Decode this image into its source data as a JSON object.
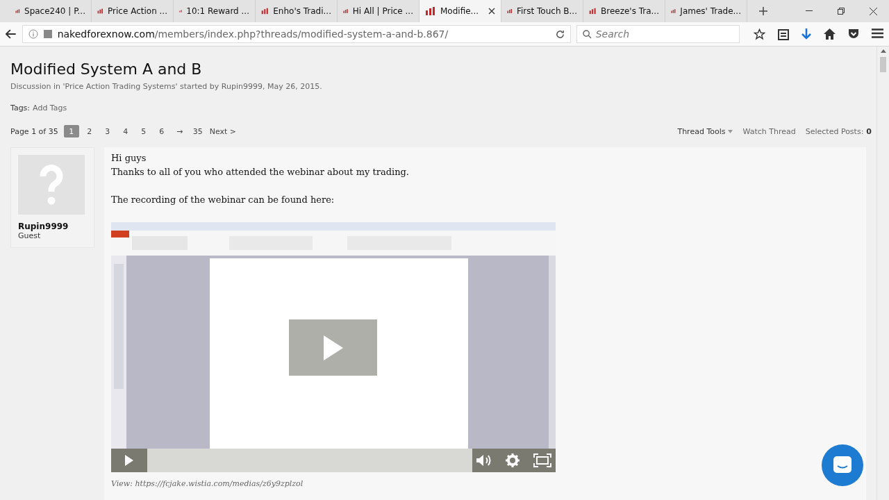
{
  "tabs": [
    {
      "title": "Space240 | P...",
      "selected": false
    },
    {
      "title": "Price Action ...",
      "selected": false
    },
    {
      "title": "10:1 Reward ...",
      "selected": false
    },
    {
      "title": "Enho's Tradi...",
      "selected": false
    },
    {
      "title": "Hi All | Price ...",
      "selected": false
    },
    {
      "title": "Modifie...",
      "selected": true
    },
    {
      "title": "First Touch B...",
      "selected": false
    },
    {
      "title": "Breeze's Tra...",
      "selected": false
    },
    {
      "title": "James' Trade...",
      "selected": false
    }
  ],
  "address": {
    "domain": "nakedforexnow.com",
    "path": "/members/index.php?threads/modified-system-a-and-b.867/",
    "search_placeholder": "Search"
  },
  "thread": {
    "title": "Modified System A and B",
    "meta": "Discussion in 'Price Action Trading Systems' started by Rupin9999, May 26, 2015.",
    "tags_label": "Tags:",
    "tags_link": "Add Tags",
    "page_label": "Page 1 of 35",
    "pages": [
      {
        "label": "1",
        "selected": true
      },
      {
        "label": "2",
        "selected": false
      },
      {
        "label": "3",
        "selected": false
      },
      {
        "label": "4",
        "selected": false
      },
      {
        "label": "5",
        "selected": false
      },
      {
        "label": "6",
        "selected": false
      }
    ],
    "skip": "→",
    "last": "35",
    "next": "Next >",
    "tools": "Thread Tools",
    "watch": "Watch Thread",
    "selected_label": "Selected Posts:",
    "selected_count": "0"
  },
  "post": {
    "author": "Rupin9999",
    "role": "Guest",
    "paragraphs": [
      [
        "Hi guys",
        "Thanks to all of you who attended the webinar about my trading."
      ],
      [
        "The recording of the webinar can be found here:"
      ]
    ],
    "video": {
      "kind": "picture"
    },
    "view": "View: https://fcjake.wistia.com/medias/z6y9zplzol"
  }
}
